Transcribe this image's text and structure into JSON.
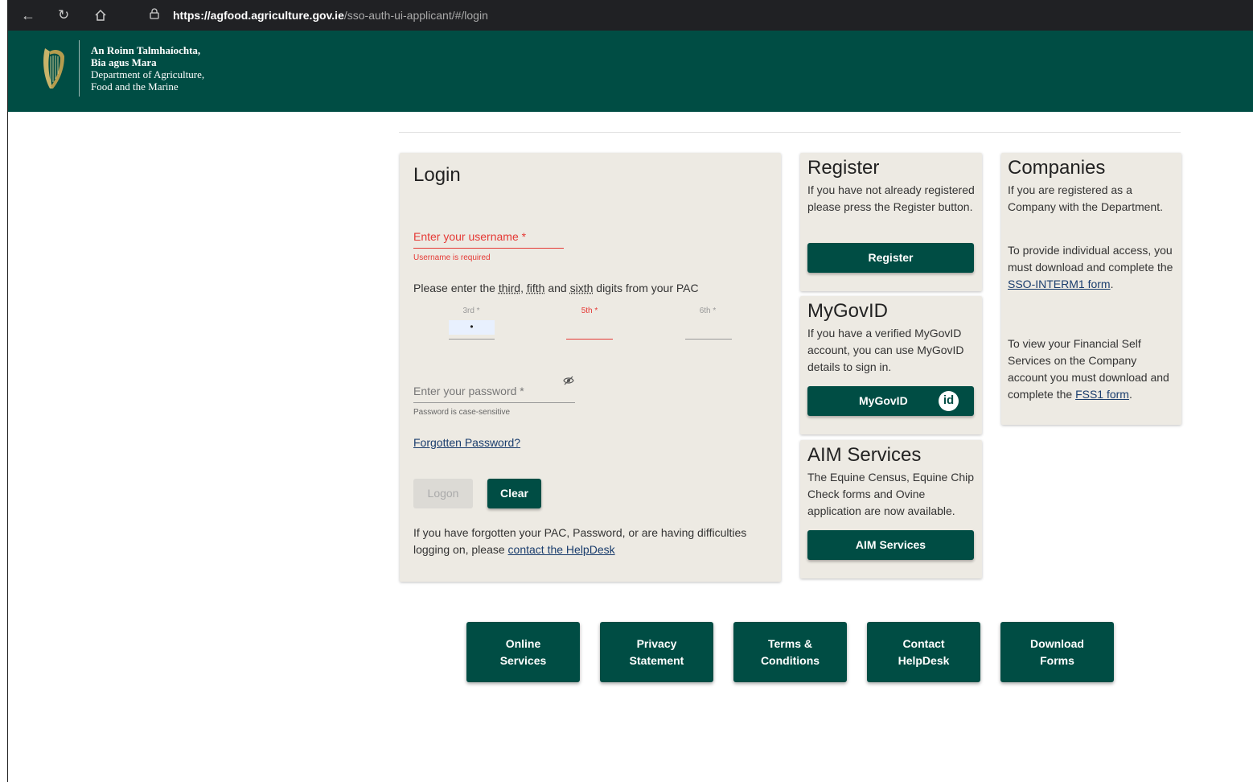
{
  "browser": {
    "url_domain": "https://agfood.agriculture.gov.ie",
    "url_path": "/sso-auth-ui-applicant/#/login"
  },
  "header": {
    "dept_irish_1": "An Roinn Talmhaíochta,",
    "dept_irish_2": "Bia agus Mara",
    "dept_english_1": "Department of Agriculture,",
    "dept_english_2": "Food and the Marine"
  },
  "login": {
    "title": "Login",
    "username_label": "Enter your username *",
    "username_error": "Username is required",
    "pac_instruction_prefix": "Please enter the ",
    "pac_third": "third",
    "pac_sep1": ", ",
    "pac_fifth": "fifth",
    "pac_sep2": " and ",
    "pac_sixth": "sixth",
    "pac_instruction_suffix": " digits from your PAC",
    "pac_3rd_label": "3rd *",
    "pac_3rd_value": "•",
    "pac_5th_label": "5th *",
    "pac_6th_label": "6th *",
    "password_label": "Enter your password *",
    "password_hint": "Password is case-sensitive",
    "forgotten_link": "Forgotten Password?",
    "logon_button": "Logon",
    "clear_button": "Clear",
    "help_text": "If you have forgotten your PAC, Password, or are having difficulties logging on, please ",
    "help_link": "contact the HelpDesk"
  },
  "register": {
    "title": "Register",
    "text": "If you have not already registered please press the Register button.",
    "button": "Register"
  },
  "mygovid": {
    "title": "MyGovID",
    "text": "If you have a verified MyGovID account, you can use MyGovID details to sign in.",
    "button": "MyGovID",
    "badge": "id"
  },
  "aim": {
    "title": "AIM Services",
    "text": "The Equine Census, Equine Chip Check forms and Ovine application are now available.",
    "button": "AIM Services"
  },
  "companies": {
    "title": "Companies",
    "text1": "If you are registered as a Company with the Department.",
    "text2_prefix": "To provide individual access, you must download and complete the ",
    "text2_link": "SSO-INTERM1 form",
    "text2_suffix": ".",
    "text3_prefix": "To view your Financial Self Services on the Company account you must download and complete the ",
    "text3_link": "FSS1 form",
    "text3_suffix": "."
  },
  "footer": {
    "online_services": "Online\nServices",
    "privacy_statement": "Privacy\nStatement",
    "terms_conditions": "Terms &\nConditions",
    "contact_helpdesk": "Contact\nHelpDesk",
    "download_forms": "Download\nForms"
  },
  "colors": {
    "brand": "#004d44",
    "error": "#e53935",
    "card_bg": "#edeae3"
  }
}
